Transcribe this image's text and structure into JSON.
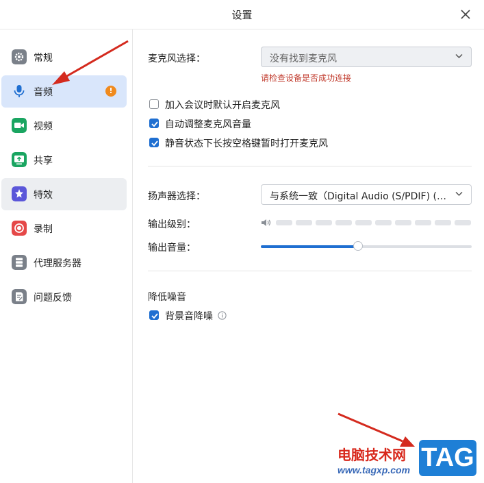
{
  "window": {
    "title": "设置"
  },
  "sidebar": {
    "items": [
      {
        "label": "常规",
        "icon": "gear-icon",
        "color": "#7a8089"
      },
      {
        "label": "音频",
        "icon": "microphone-icon",
        "color": "#1f6fd1",
        "badge": "!"
      },
      {
        "label": "视频",
        "icon": "video-camera-icon",
        "color": "#1aa561"
      },
      {
        "label": "共享",
        "icon": "share-screen-icon",
        "color": "#1aa561"
      },
      {
        "label": "特效",
        "icon": "effects-icon",
        "color": "#5b57d9"
      },
      {
        "label": "录制",
        "icon": "record-icon",
        "color": "#e54848"
      },
      {
        "label": "代理服务器",
        "icon": "proxy-server-icon",
        "color": "#7a8089"
      },
      {
        "label": "问题反馈",
        "icon": "feedback-icon",
        "color": "#7a8089"
      }
    ],
    "active_index": 1
  },
  "microphone": {
    "label": "麦克风选择：",
    "value": "没有找到麦克风",
    "error": "请检查设备是否成功连接"
  },
  "mic_options": [
    {
      "label": "加入会议时默认开启麦克风",
      "checked": false
    },
    {
      "label": "自动调整麦克风音量",
      "checked": true
    },
    {
      "label": "静音状态下长按空格键暂时打开麦克风",
      "checked": true
    }
  ],
  "speaker": {
    "label": "扬声器选择：",
    "value": "与系统一致（Digital Audio (S/PDIF) (2-...",
    "output_level_label": "输出级别：",
    "output_level": 0,
    "output_volume_label": "输出音量：",
    "output_volume": 0.46
  },
  "noise": {
    "section_label": "降低噪音",
    "option_label": "背景音降噪",
    "checked": true
  },
  "watermark": {
    "text": "电脑技术网",
    "url": "www.tagxp.com",
    "logo": "TAG"
  },
  "colors": {
    "accent": "#1f6fd1",
    "active_bg": "#d9e6fb",
    "error": "#c0392b",
    "badge": "#f08a1d",
    "annotation_arrow": "#d42a1e"
  }
}
